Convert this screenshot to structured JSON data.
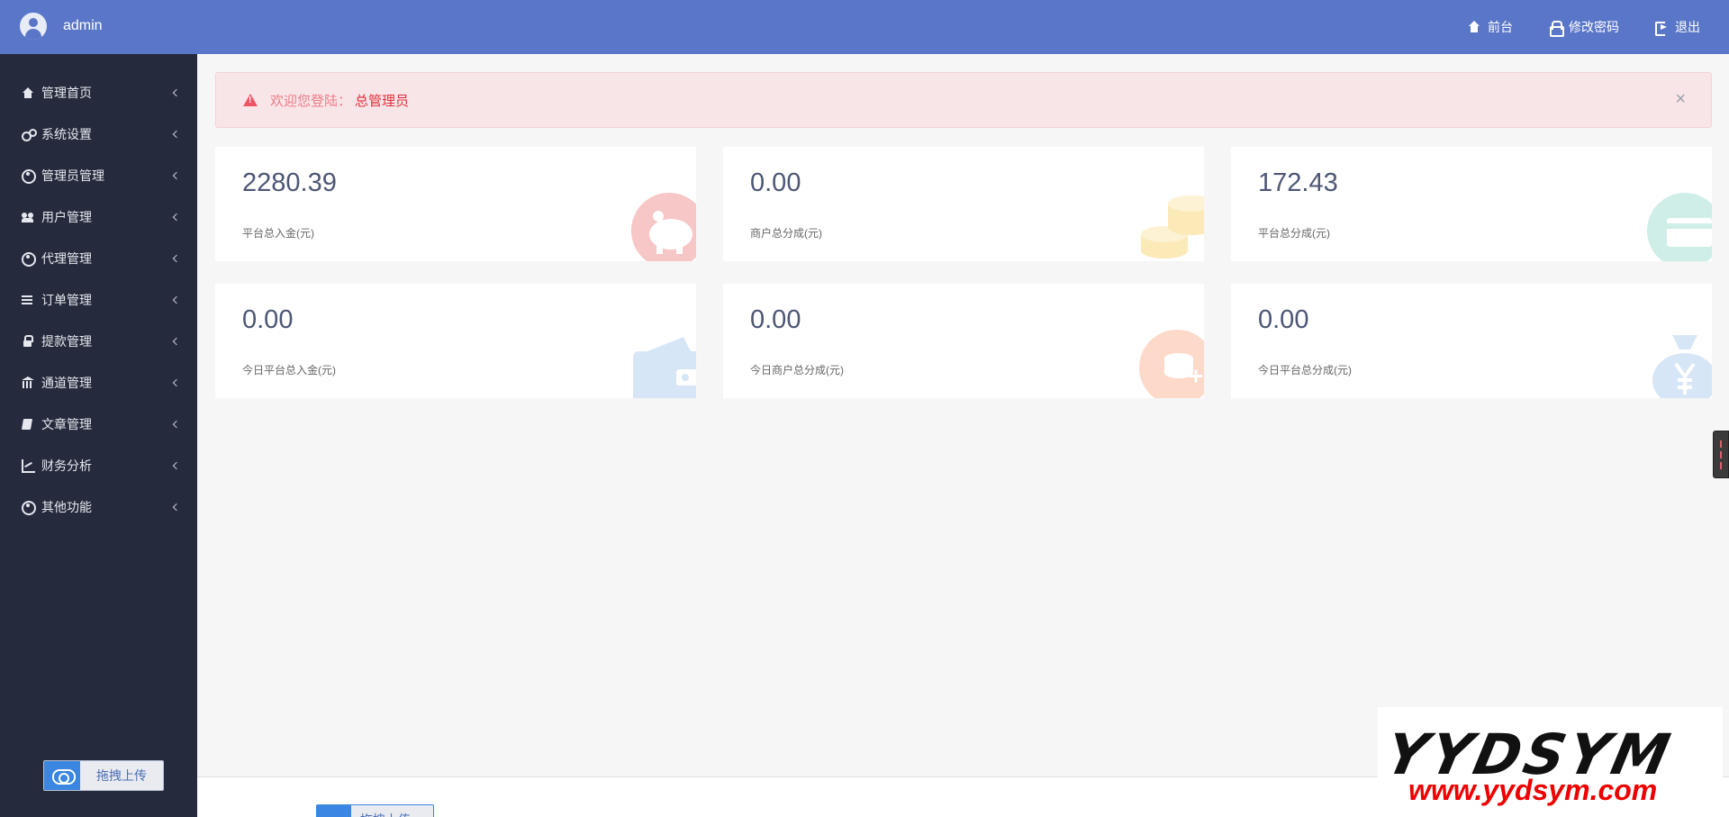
{
  "header": {
    "username": "admin",
    "nav": [
      {
        "label": "前台",
        "icon": "home-icon"
      },
      {
        "label": "修改密码",
        "icon": "lock-icon"
      },
      {
        "label": "退出",
        "icon": "sign-out-icon"
      }
    ]
  },
  "sidebar": {
    "items": [
      {
        "label": "管理首页",
        "icon": "house-icon"
      },
      {
        "label": "系统设置",
        "icon": "gears-icon"
      },
      {
        "label": "管理员管理",
        "icon": "user-circle-icon"
      },
      {
        "label": "用户管理",
        "icon": "users-icon"
      },
      {
        "label": "代理管理",
        "icon": "user-circle-icon"
      },
      {
        "label": "订单管理",
        "icon": "list-icon"
      },
      {
        "label": "提款管理",
        "icon": "lock-icon"
      },
      {
        "label": "通道管理",
        "icon": "bank-icon"
      },
      {
        "label": "文章管理",
        "icon": "book-icon"
      },
      {
        "label": "财务分析",
        "icon": "line-chart-icon"
      },
      {
        "label": "其他功能",
        "icon": "user-circle-icon"
      }
    ],
    "upload_label": "拖拽上传"
  },
  "alert": {
    "message": "欢迎您登陆：",
    "role": "总管理员",
    "close": "×"
  },
  "stats": [
    {
      "value": "2280.39",
      "label": "平台总入金(元)",
      "icon": "piggy-bank-icon",
      "color": "#f7c6c6"
    },
    {
      "value": "0.00",
      "label": "商户总分成(元)",
      "icon": "coins-icon",
      "color": "#fbe9b7"
    },
    {
      "value": "172.43",
      "label": "平台总分成(元)",
      "icon": "credit-card-icon",
      "color": "#cfeee8"
    },
    {
      "value": "0.00",
      "label": "今日平台总入金(元)",
      "icon": "wallet-icon",
      "color": "#d6e6f7"
    },
    {
      "value": "0.00",
      "label": "今日商户总分成(元)",
      "icon": "coin-plus-icon",
      "color": "#fcd9c9"
    },
    {
      "value": "0.00",
      "label": "今日平台总分成(元)",
      "icon": "money-bag-icon",
      "color": "#d6e6f7"
    }
  ],
  "footer": {
    "upload_label": "拖拽上传"
  },
  "watermark": {
    "brand": "YYDSYM",
    "url": "www.yydsym.com"
  },
  "colors": {
    "header_bg": "#5a76c8",
    "sidebar_bg": "#252b3d",
    "alert_bg": "#f8e5e8",
    "alert_text": "#f07b8a",
    "alert_role": "#e0313c"
  }
}
